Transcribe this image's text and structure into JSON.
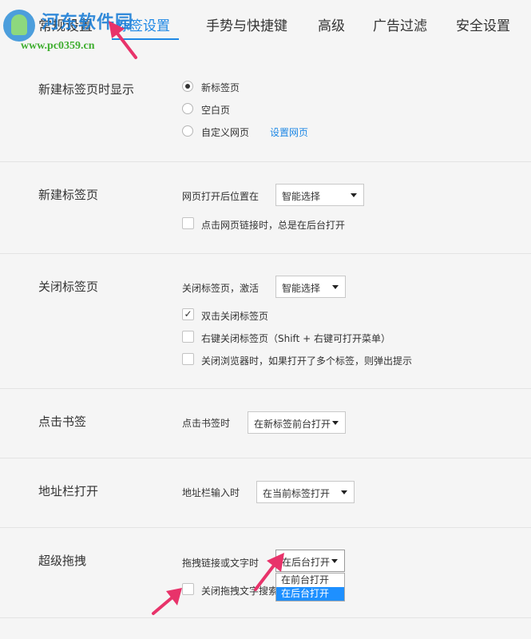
{
  "nav": {
    "tabs": [
      {
        "label": "常规设置"
      },
      {
        "label": "标签设置"
      },
      {
        "label": "手势与快捷键"
      },
      {
        "label": "高级"
      },
      {
        "label": "广告过滤"
      },
      {
        "label": "安全设置"
      }
    ],
    "active_index": 1
  },
  "watermark": {
    "title": "河东软件园",
    "url": "www.pc0359.cn"
  },
  "new_tab_display": {
    "title": "新建标签页时显示",
    "options": [
      "新标签页",
      "空白页",
      "自定义网页"
    ],
    "selected": "新标签页",
    "link": "设置网页"
  },
  "new_tab": {
    "title": "新建标签页",
    "position_label": "网页打开后位置在",
    "position_value": "智能选择",
    "background_label": "点击网页链接时，总是在后台打开",
    "background_checked": false
  },
  "close_tab": {
    "title": "关闭标签页",
    "activate_label": "关闭标签页，激活",
    "activate_value": "智能选择",
    "options": [
      {
        "label": "双击关闭标签页",
        "checked": true
      },
      {
        "label": "右键关闭标签页（Shift + 右键可打开菜单）",
        "checked": false
      },
      {
        "label": "关闭浏览器时，如果打开了多个标签，则弹出提示",
        "checked": false
      }
    ]
  },
  "bookmark_click": {
    "title": "点击书签",
    "label": "点击书签时",
    "value": "在新标签前台打开"
  },
  "address_bar": {
    "title": "地址栏打开",
    "label": "地址栏输入时",
    "value": "在当前标签打开"
  },
  "super_drag": {
    "title": "超级拖拽",
    "label": "拖拽链接或文字时",
    "value": "在后台打开",
    "dropdown_options": [
      "在前台打开",
      "在后台打开"
    ],
    "highlighted_option": "在后台打开",
    "checkbox_label": "关闭拖拽文字搜索",
    "checkbox_checked": false
  },
  "colors": {
    "accent": "#1e88e5",
    "arrow": "#e8336a",
    "highlight": "#1e90ff"
  }
}
